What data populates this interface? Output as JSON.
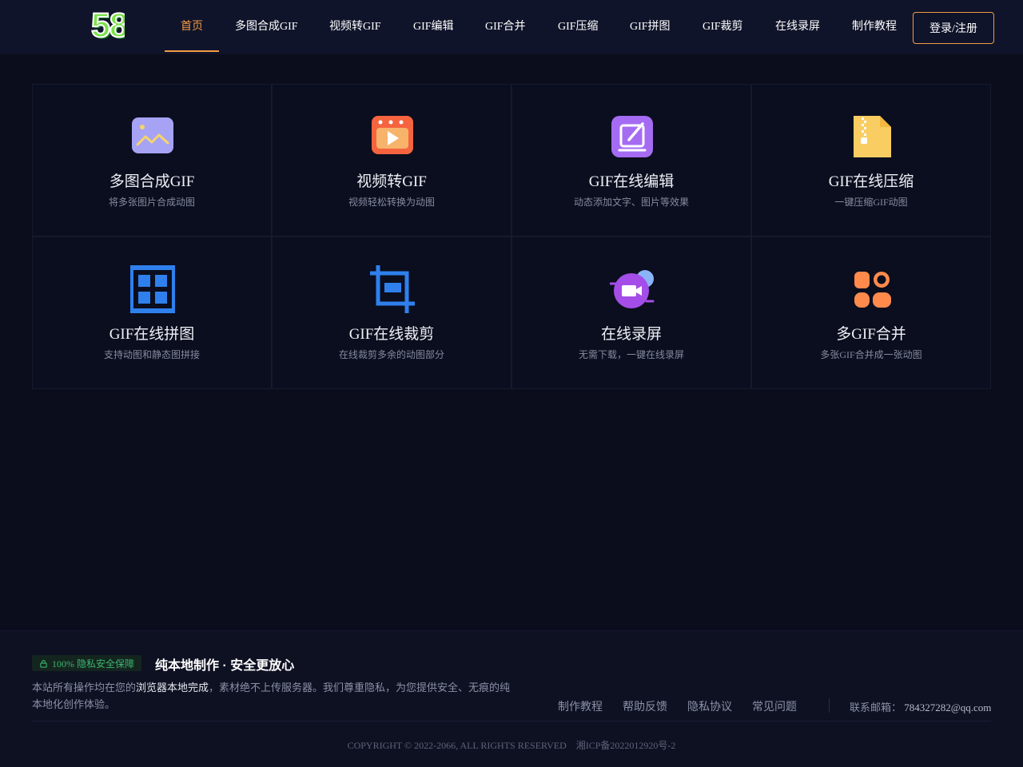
{
  "header": {
    "logo_text": "58",
    "nav": [
      {
        "label": "首页",
        "active": true
      },
      {
        "label": "多图合成GIF"
      },
      {
        "label": "视频转GIF"
      },
      {
        "label": "GIF编辑"
      },
      {
        "label": "GIF合并"
      },
      {
        "label": "GIF压缩"
      },
      {
        "label": "GIF拼图"
      },
      {
        "label": "GIF裁剪"
      },
      {
        "label": "在线录屏"
      },
      {
        "label": "制作教程"
      }
    ],
    "login_label": "登录/注册"
  },
  "tools": [
    {
      "title": "多图合成GIF",
      "desc": "将多张图片合成动图",
      "icon": "image-icon"
    },
    {
      "title": "视频转GIF",
      "desc": "视频轻松转换为动图",
      "icon": "video-icon"
    },
    {
      "title": "GIF在线编辑",
      "desc": "动态添加文字、图片等效果",
      "icon": "edit-icon"
    },
    {
      "title": "GIF在线压缩",
      "desc": "一键压缩GIF动图",
      "icon": "zip-file-icon"
    },
    {
      "title": "GIF在线拼图",
      "desc": "支持动图和静态图拼接",
      "icon": "grid-icon"
    },
    {
      "title": "GIF在线裁剪",
      "desc": "在线裁剪多余的动图部分",
      "icon": "crop-icon"
    },
    {
      "title": "在线录屏",
      "desc": "无需下载，一键在线录屏",
      "icon": "camera-icon"
    },
    {
      "title": "多GIF合并",
      "desc": "多张GIF合并成一张动图",
      "icon": "merge-icon"
    }
  ],
  "footer": {
    "badge": "100% 隐私安全保障",
    "heading": "纯本地制作 · 安全更放心",
    "desc_part1": "本站所有操作均在您的",
    "desc_highlight": "浏览器本地完成",
    "desc_part2": "，素材绝不上传服务器。我们尊重隐私，为您提供安全、无痕的纯本地化创作体验。",
    "links": [
      "制作教程",
      "帮助反馈",
      "隐私协议",
      "常见问题"
    ],
    "contact_label": "联系邮箱：",
    "contact_email": "784327282@qq.com",
    "copyright": "COPYRIGHT © 2022-2066, ALL RIGHTS RESERVED",
    "icp": "湘ICP备2022012920号-2"
  },
  "colors": {
    "accent": "#f29a45",
    "background": "#0b0d1c",
    "badge_green": "#3bb56f"
  }
}
